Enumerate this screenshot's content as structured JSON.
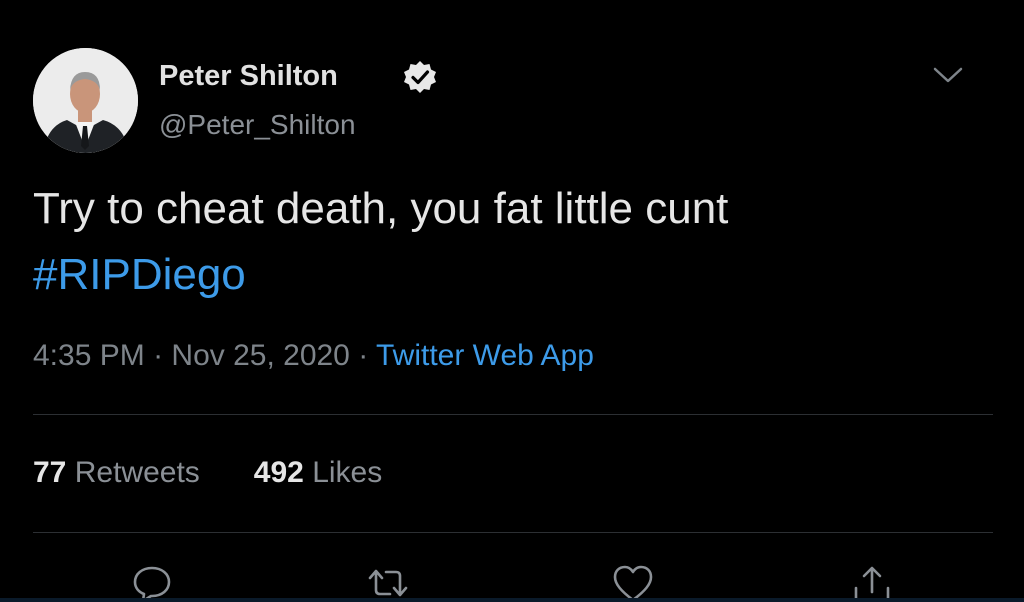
{
  "user": {
    "display_name": "Peter Shilton",
    "handle": "@Peter_Shilton"
  },
  "tweet": {
    "text": "Try to cheat death, you fat little cunt",
    "hashtag": "#RIPDiego",
    "time": "4:35 PM",
    "date": "Nov 25, 2020",
    "separator": " · ",
    "source": "Twitter Web App"
  },
  "stats": {
    "retweets_count": "77",
    "retweets_label": "Retweets",
    "likes_count": "492",
    "likes_label": "Likes"
  },
  "icons": {
    "verified": "verified-badge-icon",
    "caret": "chevron-down-icon",
    "reply": "reply-icon",
    "retweet": "retweet-icon",
    "like": "heart-icon",
    "share": "share-icon"
  },
  "colors": {
    "background": "#000000",
    "link": "#3d9be9",
    "secondary_text": "#8b9096"
  }
}
